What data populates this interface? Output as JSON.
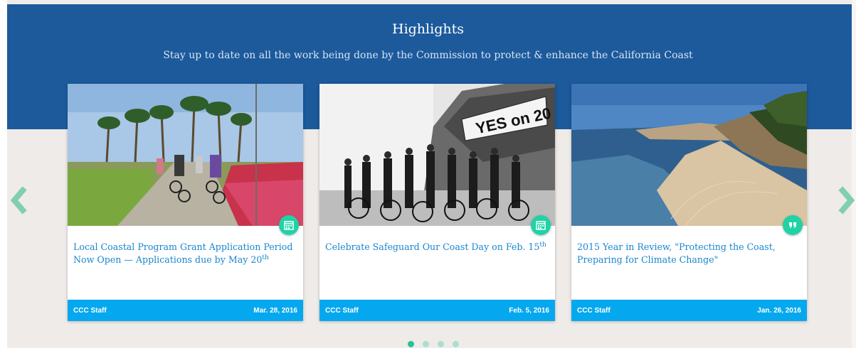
{
  "section": {
    "title": "Highlights",
    "subtitle": "Stay up to date on all the work being done by the Commission to protect & enhance the California Coast"
  },
  "cards": [
    {
      "headline": "Local Coastal Program Grant Application Period Now Open — Applications due by May 20",
      "headline_sup": "th",
      "author": "CCC Staff",
      "date": "Mar. 28, 2016",
      "badge_icon": "calendar-icon",
      "image": "cyclists on palm-lined beach path"
    },
    {
      "headline": "Celebrate Safeguard Our Coast Day on Feb. 15",
      "headline_sup": "th",
      "author": "CCC Staff",
      "date": "Feb. 5, 2016",
      "badge_icon": "calendar-icon",
      "image": "black and white group photo with YES on 20 banner"
    },
    {
      "headline": "2015 Year in Review, \"Protecting the Coast, Preparing for Climate Change\"",
      "headline_sup": "",
      "author": "CCC Staff",
      "date": "Jan. 26, 2016",
      "badge_icon": "quote-icon",
      "image": "coastal bluff and beach"
    }
  ],
  "banner_in_photo": "YES on 20",
  "carousel": {
    "pages": 4,
    "active": 1
  },
  "colors": {
    "banner": "#1c5a9c",
    "accent": "#1fd3a6",
    "footer": "#05a8ee",
    "link": "#1a86cf",
    "background": "#efebe8"
  }
}
